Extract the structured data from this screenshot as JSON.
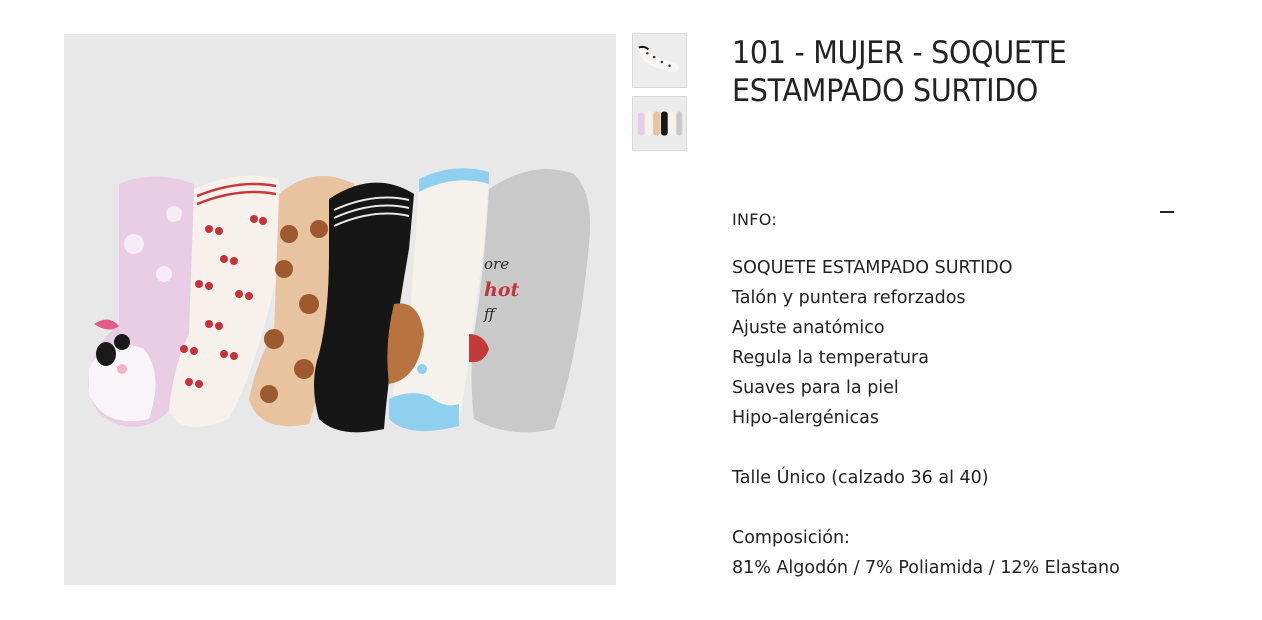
{
  "product": {
    "title_line1": "101 - MUJER - SOQUETE",
    "title_line2": "ESTAMPADO SURTIDO"
  },
  "gallery": {
    "thumbnails": [
      "thumbnail-socks-angled",
      "thumbnail-socks-pack"
    ]
  },
  "info": {
    "label": "INFO:",
    "description_lines": [
      "SOQUETE ESTAMPADO SURTIDO",
      "Talón y puntera reforzados",
      "Ajuste anatómico",
      "Regula la temperatura",
      "Suaves para la piel",
      "Hipo-alergénicas"
    ],
    "size": "Talle Único (calzado 36 al 40)",
    "composition_label": "Composición:",
    "composition": "81% Algodón / 7% Poliamida / 12% Elastano"
  },
  "sock_prints": {
    "sock5_text": [
      "ore",
      "hot",
      "ff"
    ]
  },
  "colors": {
    "image_bg": "#e9e8e9",
    "sock_pink": "#e9cde5",
    "sock_white": "#f7f1ec",
    "sock_tan": "#e8c39f",
    "sock_black": "#161616",
    "sock_blue": "#8fd0ef",
    "sock_grey": "#c9c9c9"
  }
}
